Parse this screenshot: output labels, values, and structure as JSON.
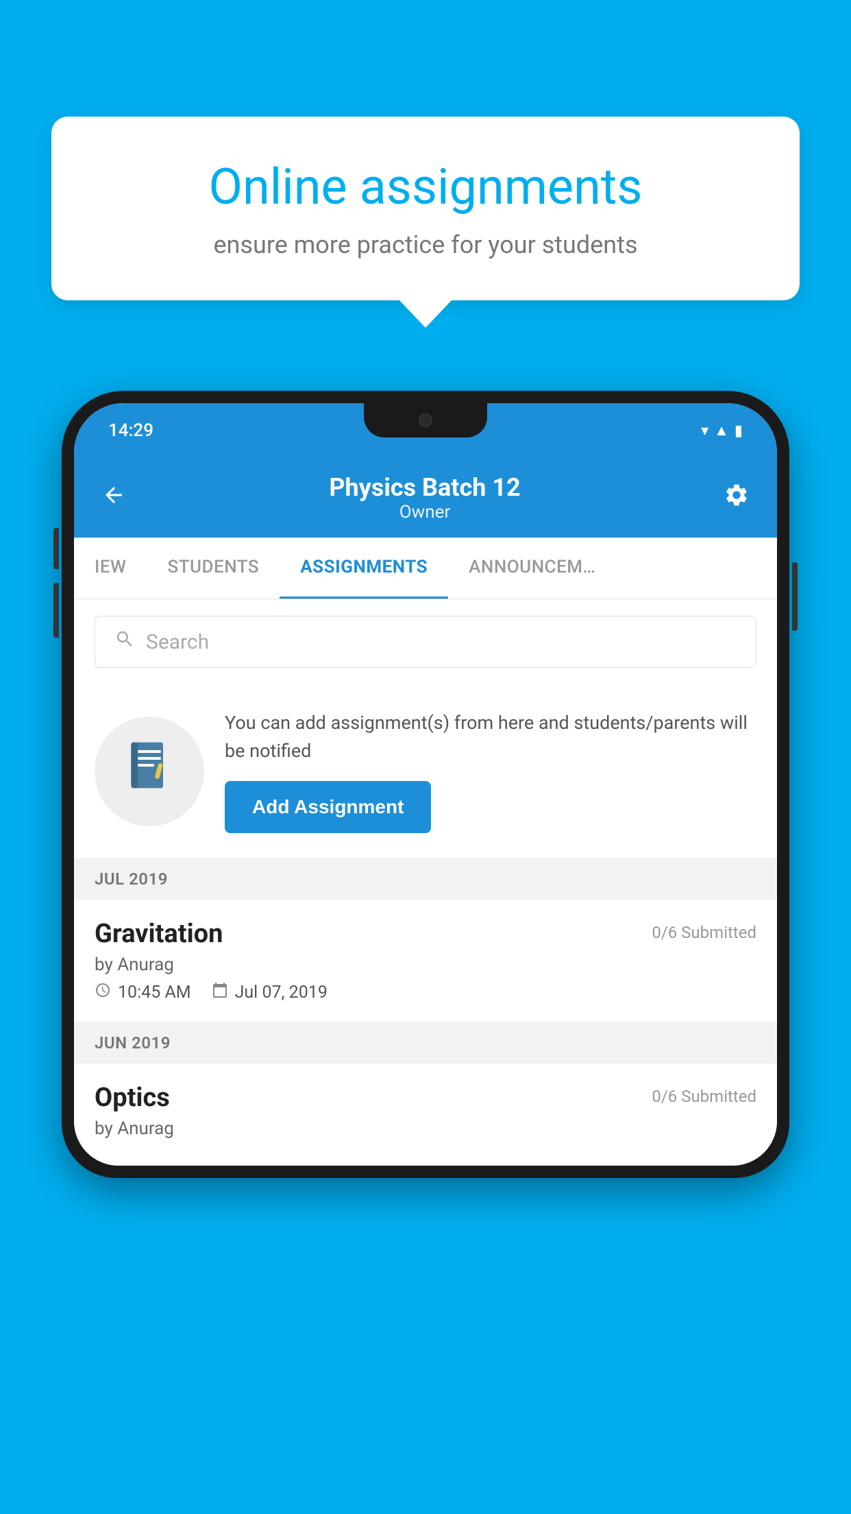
{
  "background_color": "#00AEEF",
  "speech_bubble": {
    "title": "Online assignments",
    "subtitle": "ensure more practice for your students"
  },
  "status_bar": {
    "time": "14:29",
    "wifi": "▼",
    "signal": "▲",
    "battery": "▮"
  },
  "header": {
    "title": "Physics Batch 12",
    "subtitle": "Owner",
    "back_label": "←",
    "settings_label": "⚙"
  },
  "tabs": [
    {
      "label": "IEW",
      "active": false
    },
    {
      "label": "STUDENTS",
      "active": false
    },
    {
      "label": "ASSIGNMENTS",
      "active": true
    },
    {
      "label": "ANNOUNCEM…",
      "active": false
    }
  ],
  "search": {
    "placeholder": "Search"
  },
  "info_card": {
    "text": "You can add assignment(s) from here and students/parents will be notified",
    "button_label": "Add Assignment"
  },
  "sections": [
    {
      "label": "JUL 2019",
      "assignments": [
        {
          "title": "Gravitation",
          "submitted": "0/6 Submitted",
          "by": "by Anurag",
          "time": "10:45 AM",
          "date": "Jul 07, 2019"
        }
      ]
    },
    {
      "label": "JUN 2019",
      "assignments": [
        {
          "title": "Optics",
          "submitted": "0/6 Submitted",
          "by": "by Anurag",
          "time": "",
          "date": ""
        }
      ]
    }
  ]
}
